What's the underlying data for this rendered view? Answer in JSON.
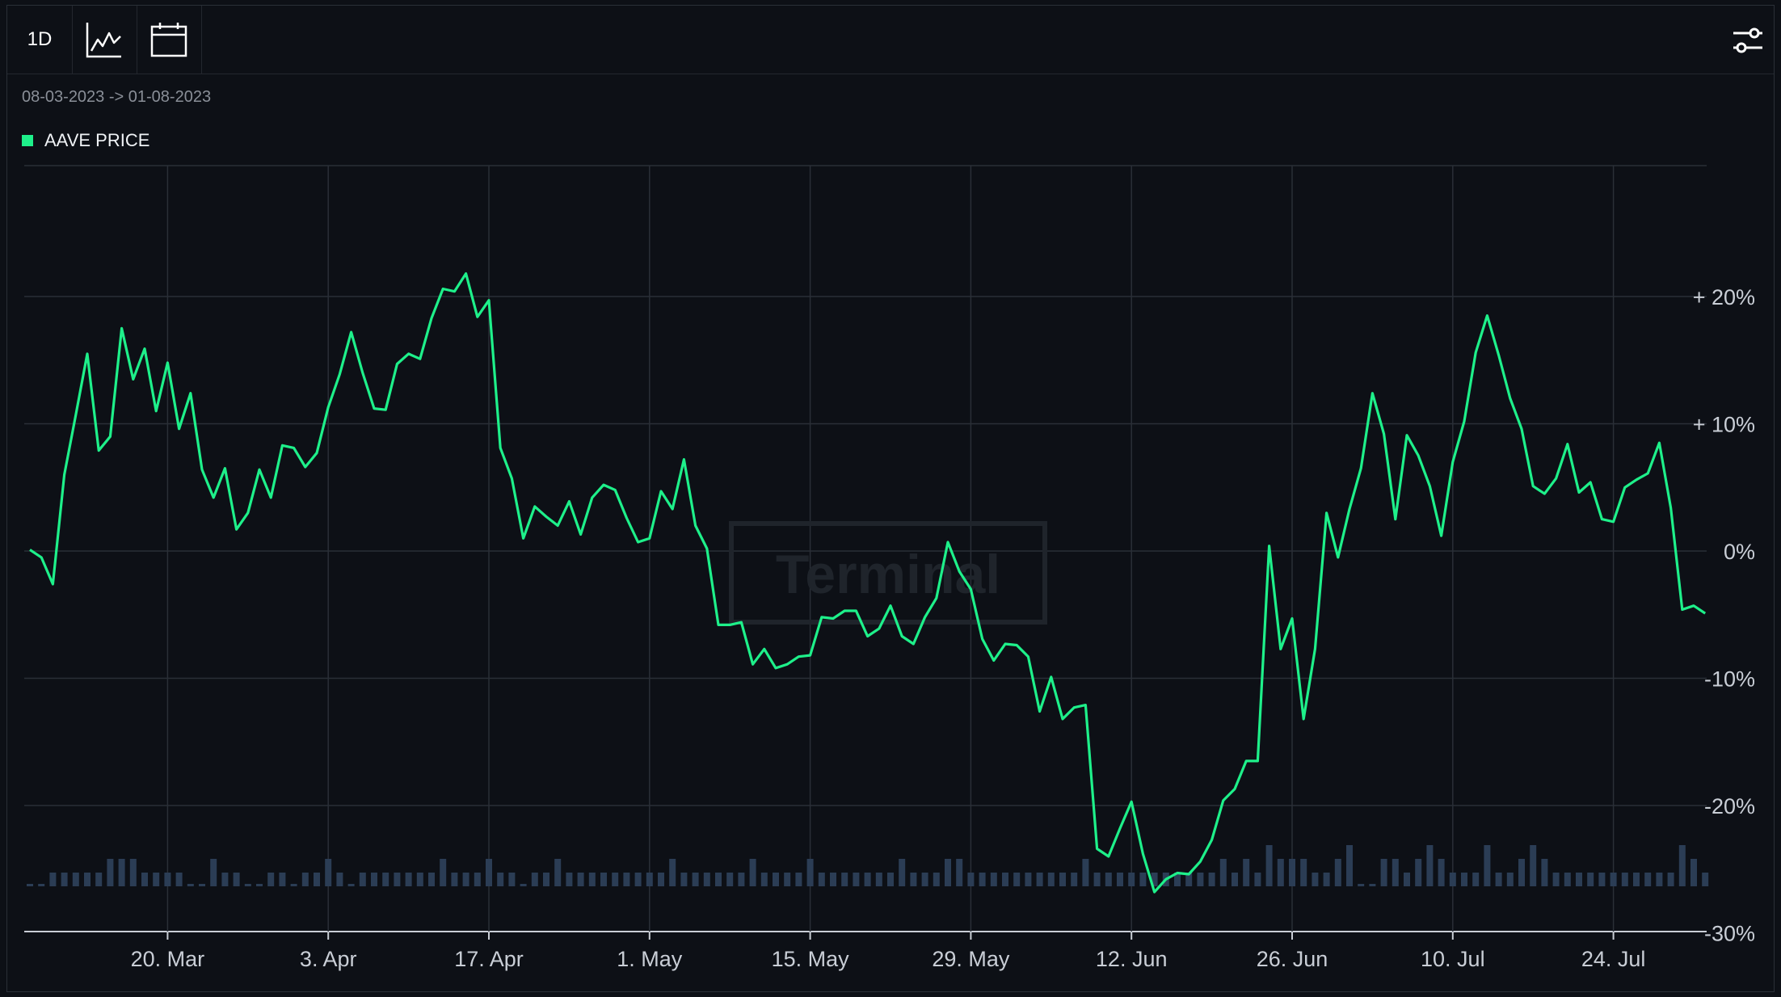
{
  "toolbar": {
    "interval_label": "1D",
    "icons": [
      "line-chart-icon",
      "calendar-icon",
      "settings-sliders-icon"
    ]
  },
  "date_range": "08-03-2023 -> 01-08-2023",
  "watermark": "Terminal",
  "colors": {
    "series": "#1ef08a",
    "volume": "#2b3d55",
    "grid": "#2a2f37",
    "background": "#0d1016"
  },
  "chart_data": {
    "type": "line",
    "title": "",
    "xlabel": "",
    "ylabel": "",
    "legend_position": "top-left",
    "grid": true,
    "x_range": [
      "2023-03-08",
      "2023-08-01"
    ],
    "ylim": [
      -30,
      30
    ],
    "x_ticks": [
      {
        "date": "2023-03-20",
        "label": "20. Mar"
      },
      {
        "date": "2023-04-03",
        "label": "3. Apr"
      },
      {
        "date": "2023-04-17",
        "label": "17. Apr"
      },
      {
        "date": "2023-05-01",
        "label": "1. May"
      },
      {
        "date": "2023-05-15",
        "label": "15. May"
      },
      {
        "date": "2023-05-29",
        "label": "29. May"
      },
      {
        "date": "2023-06-12",
        "label": "12. Jun"
      },
      {
        "date": "2023-06-26",
        "label": "26. Jun"
      },
      {
        "date": "2023-07-10",
        "label": "10. Jul"
      },
      {
        "date": "2023-07-24",
        "label": "24. Jul"
      }
    ],
    "y_ticks": [
      {
        "value": 20,
        "label": "+ 20%"
      },
      {
        "value": 10,
        "label": "+ 10%"
      },
      {
        "value": 0,
        "label": "0%"
      },
      {
        "value": -10,
        "label": "-10%"
      },
      {
        "value": -20,
        "label": "-20%"
      },
      {
        "value": -30,
        "label": "-30%"
      }
    ],
    "series": [
      {
        "name": "AAVE PRICE",
        "x": [
          "2023-03-08",
          "2023-03-09",
          "2023-03-10",
          "2023-03-11",
          "2023-03-12",
          "2023-03-13",
          "2023-03-14",
          "2023-03-15",
          "2023-03-16",
          "2023-03-17",
          "2023-03-18",
          "2023-03-19",
          "2023-03-20",
          "2023-03-21",
          "2023-03-22",
          "2023-03-23",
          "2023-03-24",
          "2023-03-25",
          "2023-03-26",
          "2023-03-27",
          "2023-03-28",
          "2023-03-29",
          "2023-03-30",
          "2023-03-31",
          "2023-04-01",
          "2023-04-02",
          "2023-04-03",
          "2023-04-04",
          "2023-04-05",
          "2023-04-06",
          "2023-04-07",
          "2023-04-08",
          "2023-04-09",
          "2023-04-10",
          "2023-04-11",
          "2023-04-12",
          "2023-04-13",
          "2023-04-14",
          "2023-04-15",
          "2023-04-16",
          "2023-04-17",
          "2023-04-18",
          "2023-04-19",
          "2023-04-20",
          "2023-04-21",
          "2023-04-22",
          "2023-04-23",
          "2023-04-24",
          "2023-04-25",
          "2023-04-26",
          "2023-04-27",
          "2023-04-28",
          "2023-04-29",
          "2023-04-30",
          "2023-05-01",
          "2023-05-02",
          "2023-05-03",
          "2023-05-04",
          "2023-05-05",
          "2023-05-06",
          "2023-05-07",
          "2023-05-08",
          "2023-05-09",
          "2023-05-10",
          "2023-05-11",
          "2023-05-12",
          "2023-05-13",
          "2023-05-14",
          "2023-05-15",
          "2023-05-16",
          "2023-05-17",
          "2023-05-18",
          "2023-05-19",
          "2023-05-20",
          "2023-05-21",
          "2023-05-22",
          "2023-05-23",
          "2023-05-24",
          "2023-05-25",
          "2023-05-26",
          "2023-05-27",
          "2023-05-28",
          "2023-05-29",
          "2023-05-30",
          "2023-05-31",
          "2023-06-01",
          "2023-06-02",
          "2023-06-03",
          "2023-06-04",
          "2023-06-05",
          "2023-06-06",
          "2023-06-07",
          "2023-06-08",
          "2023-06-09",
          "2023-06-10",
          "2023-06-11",
          "2023-06-12",
          "2023-06-13",
          "2023-06-14",
          "2023-06-15",
          "2023-06-16",
          "2023-06-17",
          "2023-06-18",
          "2023-06-19",
          "2023-06-20",
          "2023-06-21",
          "2023-06-22",
          "2023-06-23",
          "2023-06-24",
          "2023-06-25",
          "2023-06-26",
          "2023-06-27",
          "2023-06-28",
          "2023-06-29",
          "2023-06-30",
          "2023-07-01",
          "2023-07-02",
          "2023-07-03",
          "2023-07-04",
          "2023-07-05",
          "2023-07-06",
          "2023-07-07",
          "2023-07-08",
          "2023-07-09",
          "2023-07-10",
          "2023-07-11",
          "2023-07-12",
          "2023-07-13",
          "2023-07-14",
          "2023-07-15",
          "2023-07-16",
          "2023-07-17",
          "2023-07-18",
          "2023-07-19",
          "2023-07-20",
          "2023-07-21",
          "2023-07-22",
          "2023-07-23",
          "2023-07-24",
          "2023-07-25",
          "2023-07-26",
          "2023-07-27",
          "2023-07-28",
          "2023-07-29",
          "2023-07-30",
          "2023-07-31",
          "2023-08-01"
        ],
        "values": [
          0.1,
          -0.5,
          -2.6,
          6,
          10.7,
          15.5,
          7.9,
          9,
          17.5,
          13.5,
          15.9,
          11,
          14.8,
          9.6,
          12.4,
          6.4,
          4.2,
          6.5,
          1.7,
          3,
          6.4,
          4.2,
          8.3,
          8.1,
          6.6,
          7.7,
          11.3,
          13.9,
          17.2,
          14,
          11.2,
          11.1,
          14.7,
          15.5,
          15.1,
          18.3,
          20.6,
          20.4,
          21.8,
          18.4,
          19.7,
          8.1,
          5.7,
          1,
          3.5,
          2.7,
          2,
          3.9,
          1.3,
          4.2,
          5.2,
          4.8,
          2.6,
          0.7,
          1,
          4.7,
          3.3,
          7.2,
          2,
          0.2,
          -5.8,
          -5.8,
          -5.6,
          -8.9,
          -7.7,
          -9.2,
          -8.9,
          -8.3,
          -8.2,
          -5.2,
          -5.3,
          -4.7,
          -4.7,
          -6.7,
          -6.1,
          -4.3,
          -6.7,
          -7.3,
          -5.2,
          -3.7,
          0.7,
          -1.6,
          -3,
          -6.9,
          -8.6,
          -7.3,
          -7.4,
          -8.3,
          -12.6,
          -9.9,
          -13.2,
          -12.3,
          -12.1,
          -23.4,
          -24,
          -21.8,
          -19.7,
          -23.8,
          -26.8,
          -25.8,
          -25.3,
          -25.4,
          -24.4,
          -22.7,
          -19.6,
          -18.7,
          -16.5,
          -16.5,
          0.4,
          -7.7,
          -5.3,
          -13.2,
          -7.7,
          3,
          -0.5,
          3.3,
          6.5,
          12.4,
          9.2,
          2.5,
          9.1,
          7.5,
          5.1,
          1.2,
          7,
          10.2,
          15.6,
          18.5,
          15.4,
          12,
          9.6,
          5.1,
          4.5,
          5.7,
          8.4,
          4.6,
          5.4,
          2.5,
          2.3,
          5,
          5.6,
          6.1,
          8.5,
          3.4,
          -4.6,
          -4.3,
          -4.9
        ]
      }
    ],
    "volume": [
      0,
      0,
      1,
      1,
      1,
      1,
      1,
      2,
      2,
      2,
      1,
      1,
      1,
      1,
      0,
      0,
      2,
      1,
      1,
      0,
      0,
      1,
      1,
      0,
      1,
      1,
      2,
      1,
      0,
      1,
      1,
      1,
      1,
      1,
      1,
      1,
      2,
      1,
      1,
      1,
      2,
      1,
      1,
      0,
      1,
      1,
      2,
      1,
      1,
      1,
      1,
      1,
      1,
      1,
      1,
      1,
      2,
      1,
      1,
      1,
      1,
      1,
      1,
      2,
      1,
      1,
      1,
      1,
      2,
      1,
      1,
      1,
      1,
      1,
      1,
      1,
      2,
      1,
      1,
      1,
      2,
      2,
      1,
      1,
      1,
      1,
      1,
      1,
      1,
      1,
      1,
      1,
      2,
      1,
      1,
      1,
      1,
      1,
      1,
      1,
      1,
      1,
      1,
      1,
      2,
      1,
      2,
      1,
      3,
      2,
      2,
      2,
      1,
      1,
      2,
      3,
      0,
      0,
      2,
      2,
      1,
      2,
      3,
      2,
      1,
      1,
      1,
      3,
      1,
      1,
      2,
      3,
      2,
      1,
      1,
      1,
      1,
      1,
      1,
      1,
      1,
      1,
      1,
      1,
      3,
      2,
      1,
      2,
      1,
      3,
      2
    ]
  }
}
